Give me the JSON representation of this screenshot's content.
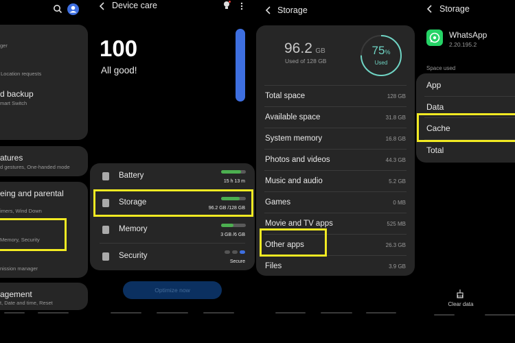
{
  "settings": {
    "item1_sub": "ger",
    "item2_sub": "Location requests",
    "item3_title": "d backup",
    "item3_sub": "mart Switch",
    "item4_title": "atures",
    "item4_sub": "d gestures, One-handed mode",
    "item5_title": "eing and parental",
    "item5_sub": "imers, Wind Down",
    "item6_sub": "Memory, Security",
    "item7_sub": "nission manager",
    "item8_title": "agement",
    "item8_sub": "t, Date and time, Reset"
  },
  "device_care": {
    "title": "Device care",
    "score": "100",
    "status": "All good!",
    "items": [
      {
        "label": "Battery",
        "value": "15 h 13 m",
        "level": 0.8
      },
      {
        "label": "Storage",
        "value": "96.2 GB /128 GB",
        "level": 0.75
      },
      {
        "label": "Memory",
        "value": "3 GB /6 GB",
        "level": 0.5
      },
      {
        "label": "Security",
        "value": "Secure"
      }
    ],
    "optimize_label": "Optimize now"
  },
  "storage": {
    "title": "Storage",
    "used_value": "96.2",
    "used_unit": "GB",
    "used_of": "Used of 128 GB",
    "percent": "75",
    "percent_sign": "%",
    "percent_label": "Used",
    "percent_fraction": 0.75,
    "rows": [
      {
        "label": "Total space",
        "value": "128 GB"
      },
      {
        "label": "Available space",
        "value": "31.8 GB"
      },
      {
        "label": "System memory",
        "value": "16.8 GB"
      },
      {
        "label": "Photos and videos",
        "value": "44.3 GB"
      },
      {
        "label": "Music and audio",
        "value": "5.2 GB"
      },
      {
        "label": "Games",
        "value": "0 MB"
      },
      {
        "label": "Movie and TV apps",
        "value": "525 MB"
      },
      {
        "label": "Other apps",
        "value": "26.3 GB"
      },
      {
        "label": "Files",
        "value": "3.9 GB"
      }
    ]
  },
  "app_storage": {
    "title": "Storage",
    "app_name": "WhatsApp",
    "app_version": "2.20.195.2",
    "section": "Space used",
    "rows": [
      "App",
      "Data",
      "Cache",
      "Total"
    ],
    "clear_label": "Clear data"
  },
  "colors": {
    "highlight": "#f2ea22",
    "accent_blue": "#3e6fe0",
    "bar_green": "#4caf50",
    "ring_teal": "#6fd4c4",
    "whatsapp_green": "#25d366"
  }
}
